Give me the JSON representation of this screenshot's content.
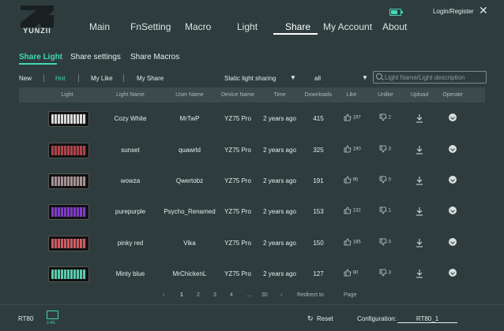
{
  "brand": {
    "name": "YUNZII"
  },
  "nav": {
    "items": [
      {
        "label": "Main"
      },
      {
        "label": "FnSetting"
      },
      {
        "label": "Macro"
      },
      {
        "label": "Light"
      },
      {
        "label": "Share"
      },
      {
        "label": "My Account"
      },
      {
        "label": "About"
      }
    ],
    "active": "Share"
  },
  "top_right": {
    "login_label": "Login/Register",
    "battery_icon": "battery-icon",
    "close_icon": "close-icon"
  },
  "subtabs": {
    "items": [
      {
        "label": "Share Light"
      },
      {
        "label": "Share settings"
      },
      {
        "label": "Share Macros"
      }
    ],
    "active": "Share Light"
  },
  "filters": {
    "items": [
      {
        "label": "New"
      },
      {
        "label": "Hot"
      },
      {
        "label": "My Like"
      },
      {
        "label": "My Share"
      }
    ],
    "active": "Hot",
    "type_dropdown": "Static light sharing",
    "device_dropdown": "all",
    "search_placeholder": "Light Name/Light description"
  },
  "table": {
    "headers": [
      "Light",
      "Light Name",
      "User Name",
      "Device Name",
      "Time",
      "Downloads",
      "Like",
      "Unlike",
      "Upload",
      "Operate"
    ],
    "rows": [
      {
        "light_name": "Cozy White",
        "user": "MrTwP",
        "device": "YZ75 Pro",
        "time": "2 years ago",
        "downloads": "415",
        "likes": "197",
        "unlikes": "2",
        "thumb_color": "#f0f0f0"
      },
      {
        "light_name": "sunset",
        "user": "quawrld",
        "device": "YZ75 Pro",
        "time": "2 years ago",
        "downloads": "325",
        "likes": "190",
        "unlikes": "3",
        "thumb_color": "#c4474e"
      },
      {
        "light_name": "wowza",
        "user": "Qwertobz",
        "device": "YZ75 Pro",
        "time": "2 years ago",
        "downloads": "191",
        "likes": "95",
        "unlikes": "0",
        "thumb_color": "#b79ea3"
      },
      {
        "light_name": "purepurple",
        "user": "Psycho_Renamed",
        "device": "YZ75 Pro",
        "time": "2 years ago",
        "downloads": "153",
        "likes": "132",
        "unlikes": "1",
        "thumb_color": "#8b3ee0"
      },
      {
        "light_name": "pinky red",
        "user": "Vika",
        "device": "YZ75 Pro",
        "time": "2 years ago",
        "downloads": "150",
        "likes": "185",
        "unlikes": "0",
        "thumb_color": "#e2646a"
      },
      {
        "light_name": "Minty blue",
        "user": "MrChickenL",
        "device": "YZ75 Pro",
        "time": "2 years ago",
        "downloads": "127",
        "likes": "90",
        "unlikes": "3",
        "thumb_color": "#5ee0bf"
      }
    ]
  },
  "pagination": {
    "prev": "‹",
    "pages": [
      "1",
      "2",
      "3",
      "4",
      "...",
      "30"
    ],
    "next": "›",
    "current": "1",
    "redirect_label": "Redirect to",
    "page_label": "Page"
  },
  "footer": {
    "device": "RT80",
    "connection": "2.4G",
    "reset_label": "Reset",
    "config_label": "Configuration:",
    "config_value": "RT80_1"
  },
  "colors": {
    "accent": "#43d7b6",
    "background": "#2e3c3d",
    "header_row": "#3d4a4b"
  }
}
